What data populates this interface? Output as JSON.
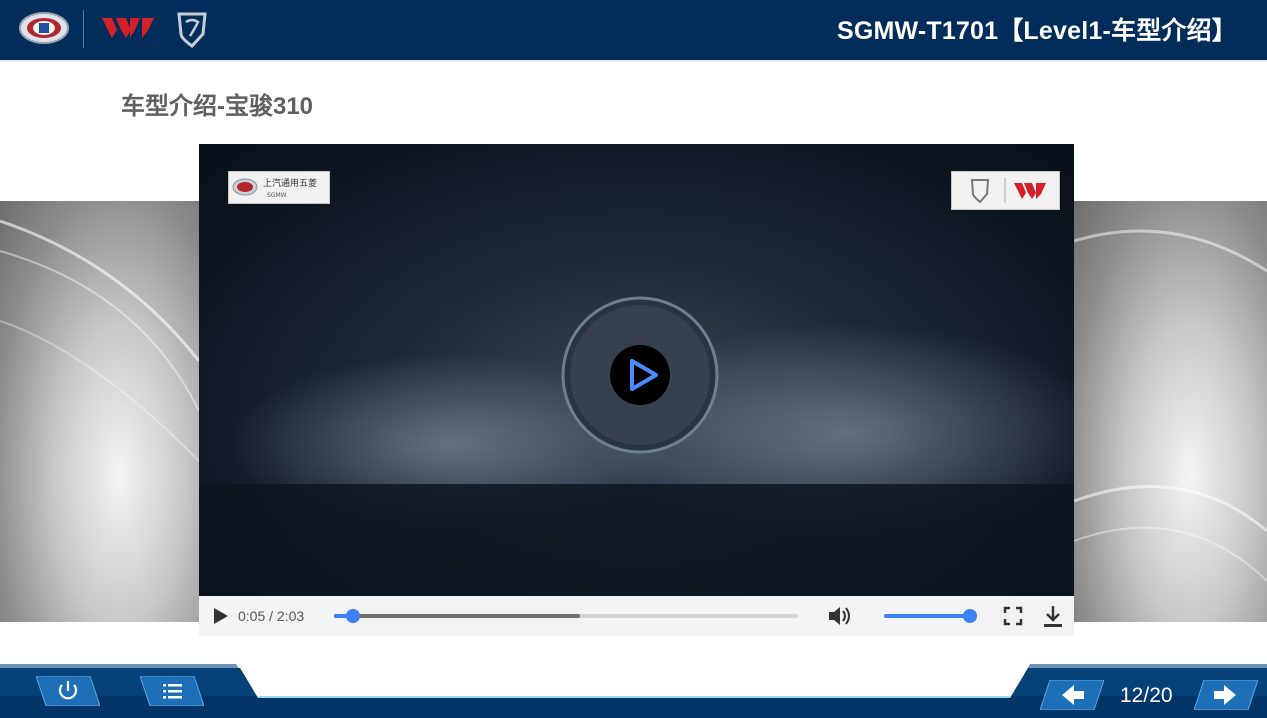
{
  "header": {
    "title": "SGMW-T1701【Level1-车型介绍】",
    "logos": [
      "sgmw-logo",
      "wuling-logo",
      "baojun-logo"
    ]
  },
  "slide": {
    "title": "车型介绍-宝骏310"
  },
  "video": {
    "watermark_left_text": "上汽通用五菱",
    "watermark_left_sub": "SGMW",
    "current_time": "0:05",
    "total_time": "2:03",
    "time_separator": " / ",
    "progress_fraction": 0.04,
    "buffered_fraction": 0.53,
    "volume_fraction": 1.0
  },
  "footer": {
    "page_counter": "12/20",
    "buttons": [
      "power-icon",
      "menu-list-icon",
      "arrow-left-icon",
      "arrow-right-icon"
    ]
  },
  "colors": {
    "header_bg": "#022c5a",
    "accent": "#3b82f6",
    "footer_bg": "#023466",
    "title_gray": "#606060"
  }
}
